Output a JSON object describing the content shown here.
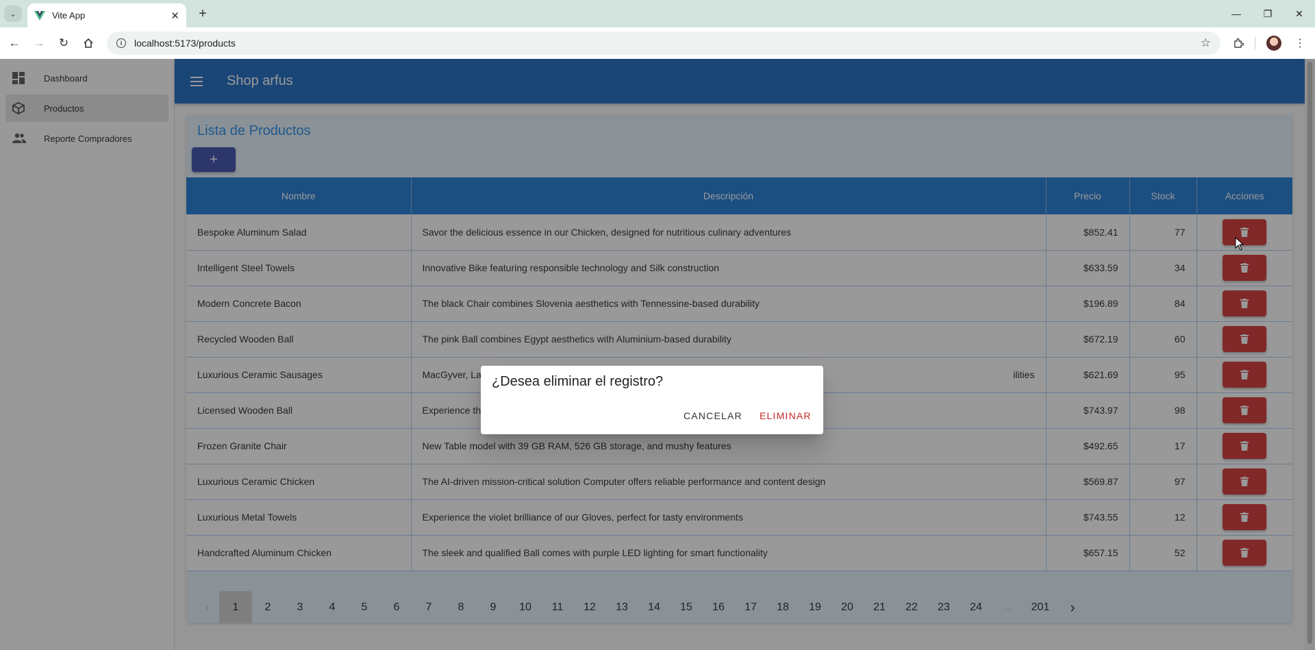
{
  "browser": {
    "tab_title": "Vite App",
    "url": "localhost:5173/products",
    "icons": [
      "tab-search-icon",
      "vue-logo-icon",
      "close-icon",
      "new-tab-icon",
      "minimize-icon",
      "restore-icon",
      "window-close-icon",
      "back-icon",
      "forward-icon",
      "reload-icon",
      "home-icon",
      "site-info-icon",
      "bookmark-star-icon",
      "extensions-icon",
      "profile-avatar"
    ]
  },
  "sidebar": {
    "items": [
      {
        "label": "Dashboard",
        "icon": "dashboard-icon",
        "active": false
      },
      {
        "label": "Productos",
        "icon": "cube-icon",
        "active": true
      },
      {
        "label": "Reporte Compradores",
        "icon": "people-icon",
        "active": false
      }
    ]
  },
  "appbar": {
    "title": "Shop arfus",
    "menu_icon": "hamburger-menu-icon",
    "color": "#1565c0"
  },
  "page": {
    "title": "Lista de Productos",
    "add_label": "+",
    "columns": [
      "Nombre",
      "Descripción",
      "Precio",
      "Stock",
      "Acciones"
    ],
    "rows": [
      {
        "name": "Bespoke Aluminum Salad",
        "description": "Savor the delicious essence in our Chicken, designed for nutritious culinary adventures",
        "price": "$852.41",
        "stock": "77"
      },
      {
        "name": "Intelligent Steel Towels",
        "description": "Innovative Bike featuring responsible technology and Silk construction",
        "price": "$633.59",
        "stock": "34"
      },
      {
        "name": "Modern Concrete Bacon",
        "description": "The black Chair combines Slovenia aesthetics with Tennessine-based durability",
        "price": "$196.89",
        "stock": "84"
      },
      {
        "name": "Recycled Wooden Ball",
        "description": "The pink Ball combines Egypt aesthetics with Aluminium-based durability",
        "price": "$672.19",
        "stock": "60"
      },
      {
        "name": "Luxurious Ceramic Sausages",
        "description": "MacGyver, La",
        "description_tail": "ilities",
        "price": "$621.69",
        "stock": "95"
      },
      {
        "name": "Licensed Wooden Ball",
        "description": "Experience th",
        "price": "$743.97",
        "stock": "98"
      },
      {
        "name": "Frozen Granite Chair",
        "description": "New Table model with 39 GB RAM, 526 GB storage, and mushy features",
        "price": "$492.65",
        "stock": "17"
      },
      {
        "name": "Luxurious Ceramic Chicken",
        "description": "The AI-driven mission-critical solution Computer offers reliable performance and content design",
        "price": "$569.87",
        "stock": "97"
      },
      {
        "name": "Luxurious Metal Towels",
        "description": "Experience the violet brilliance of our Gloves, perfect for tasty environments",
        "price": "$743.55",
        "stock": "12"
      },
      {
        "name": "Handcrafted Aluminum Chicken",
        "description": "The sleek and qualified Ball comes with purple LED lighting for smart functionality",
        "price": "$657.15",
        "stock": "52"
      }
    ],
    "delete_icon": "trash-icon",
    "delete_color": "#d32f2f"
  },
  "pagination": {
    "prev_icon": "chevron-left-icon",
    "next_icon": "chevron-right-icon",
    "pages": [
      "1",
      "2",
      "3",
      "4",
      "5",
      "6",
      "7",
      "8",
      "9",
      "10",
      "11",
      "12",
      "13",
      "14",
      "15",
      "16",
      "17",
      "18",
      "19",
      "20",
      "21",
      "22",
      "23",
      "24"
    ],
    "ellipsis": "...",
    "last": "201",
    "current": "1"
  },
  "dialog": {
    "title": "¿Desea eliminar el registro?",
    "cancel": "CANCELAR",
    "confirm": "ELIMINAR",
    "confirm_color": "#c62828"
  }
}
